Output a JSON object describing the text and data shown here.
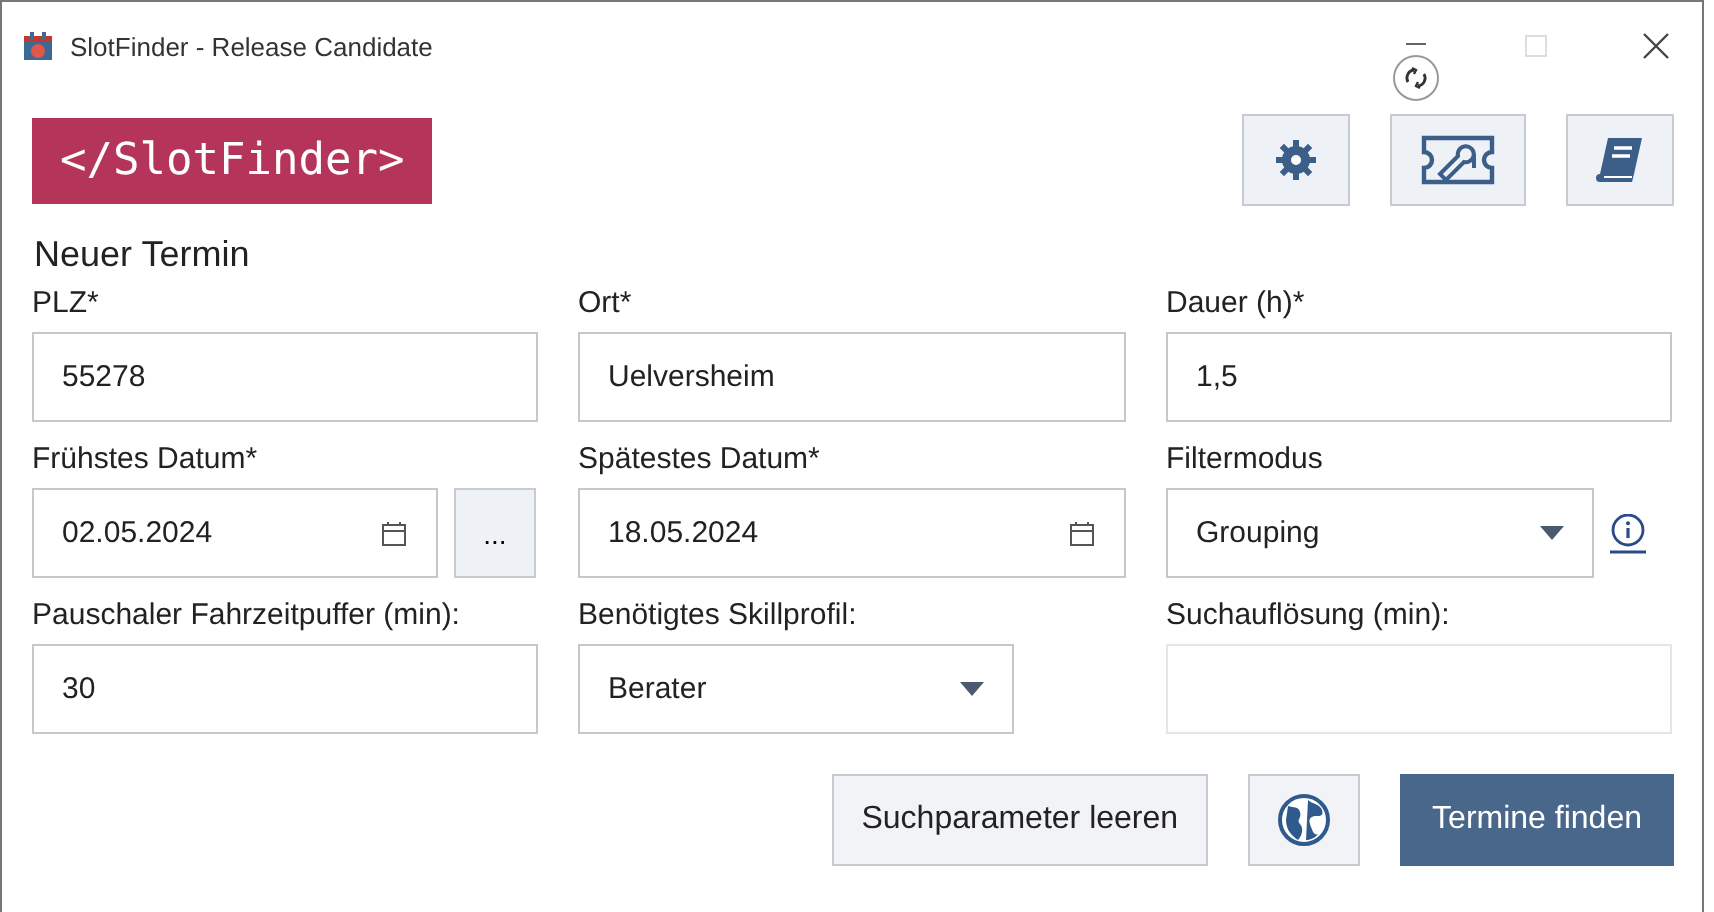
{
  "window": {
    "title": "SlotFinder - Release Candidate",
    "maximize_disabled": true
  },
  "logo": "</SlotFinder>",
  "toolbar": [
    {
      "kind": "gear"
    },
    {
      "kind": "ticket-wrench"
    },
    {
      "kind": "book"
    }
  ],
  "section_title": "Neuer Termin",
  "rows": [
    [
      {
        "label": "PLZ*",
        "kind": "text",
        "value": "55278",
        "disabled": false
      },
      {
        "label": "Ort*",
        "kind": "text",
        "value": "Uelversheim",
        "disabled": false
      },
      {
        "label": "Dauer (h)*",
        "kind": "text",
        "value": "1,5",
        "disabled": false
      }
    ],
    [
      {
        "label": "Frühstes Datum*",
        "kind": "date",
        "value": "02.05.2024",
        "extra_button": "..."
      },
      {
        "label": "Spätestes Datum*",
        "kind": "date",
        "value": "18.05.2024"
      },
      {
        "label": "Filtermodus",
        "kind": "select",
        "value": "Grouping",
        "info": true
      }
    ],
    [
      {
        "label": "Pauschaler Fahrzeitpuffer (min):",
        "kind": "text",
        "value": "30",
        "disabled": false
      },
      {
        "label": "Benötigtes Skillprofil:",
        "kind": "select",
        "value": "Berater"
      },
      {
        "label": "Suchauflösung (min):",
        "kind": "text",
        "disabled": true
      }
    ]
  ],
  "buttons": [
    {
      "kind": "secondary",
      "label": "Suchparameter leeren"
    },
    {
      "kind": "globe"
    },
    {
      "kind": "primary",
      "label": "Termine finden"
    }
  ]
}
